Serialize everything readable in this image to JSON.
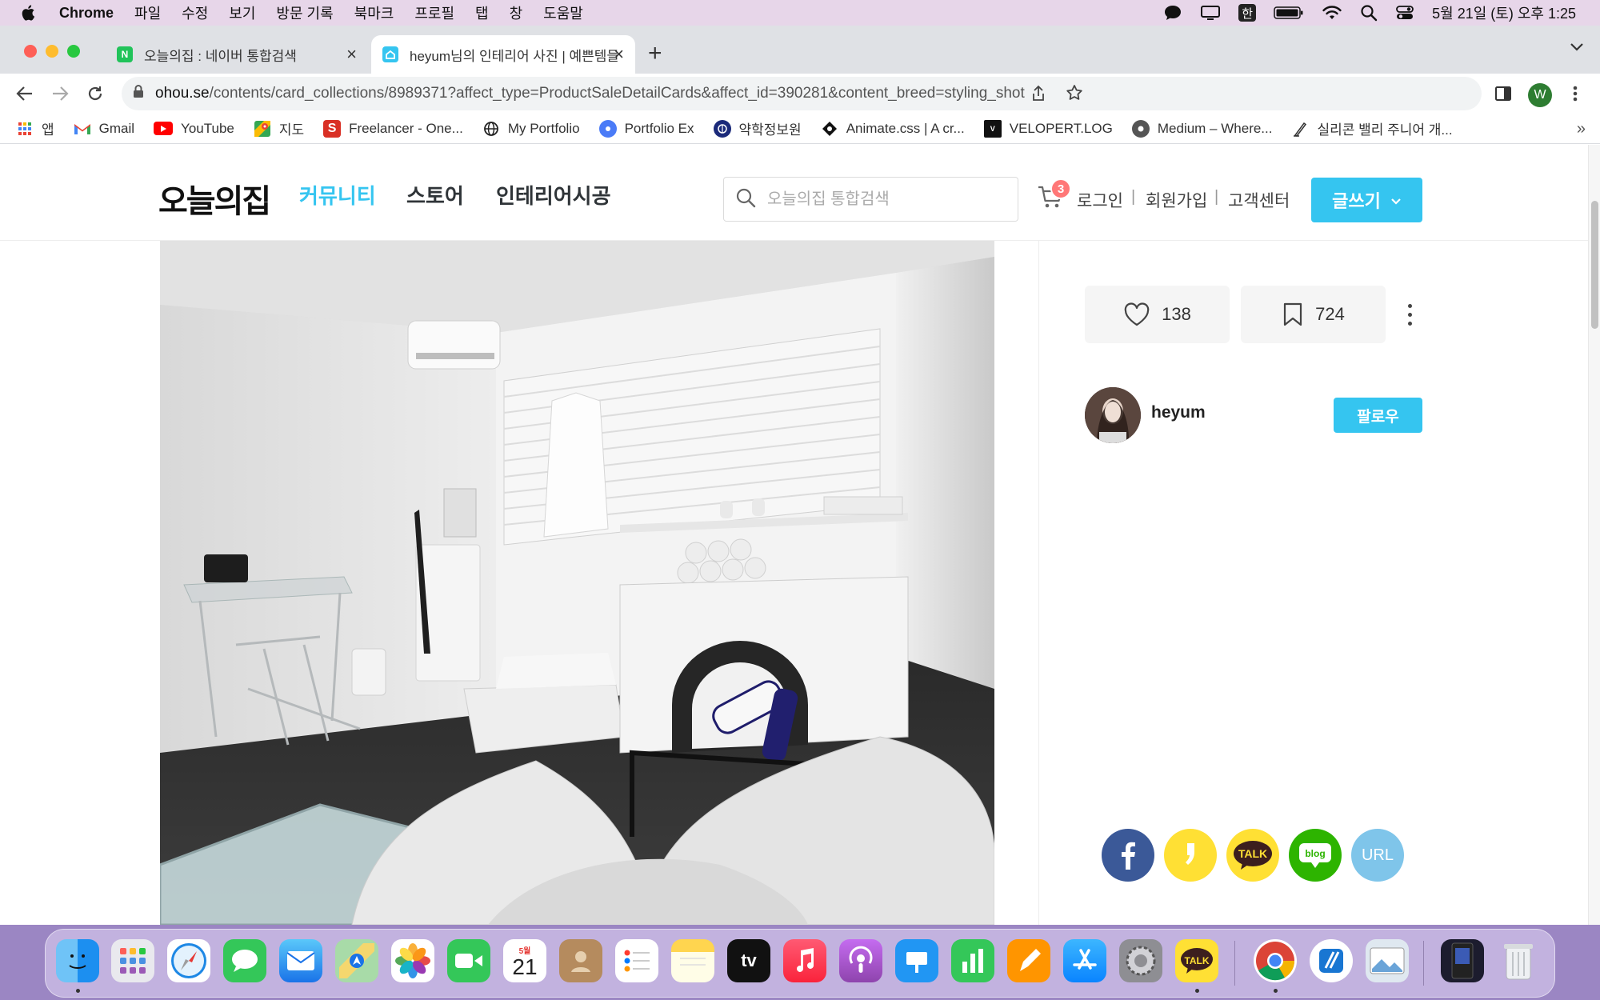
{
  "menubar": {
    "app_name": "Chrome",
    "items": [
      "파일",
      "수정",
      "보기",
      "방문 기록",
      "북마크",
      "프로필",
      "탭",
      "창",
      "도움말"
    ],
    "input_method": "한",
    "clock": "5월 21일 (토) 오후 1:25"
  },
  "tabs": [
    {
      "title": "오늘의집 : 네이버 통합검색",
      "favicon": "N",
      "active": false
    },
    {
      "title": "heyum님의 인테리어 사진 | 예쁜템들",
      "favicon": "house",
      "active": true
    }
  ],
  "toolbar": {
    "url_host": "ohou.se",
    "url_path": "/contents/card_collections/8989371?affect_type=ProductSaleDetailCards&affect_id=390281&content_breed=styling_shot",
    "profile_initial": "W"
  },
  "bookmarks": {
    "items": [
      {
        "label": "앱",
        "icon": "apps-grid-icon"
      },
      {
        "label": "Gmail",
        "icon": "gmail-icon"
      },
      {
        "label": "YouTube",
        "icon": "youtube-icon"
      },
      {
        "label": "지도",
        "icon": "maps-icon"
      },
      {
        "label": "Freelancer - One...",
        "icon": "freelancer-icon"
      },
      {
        "label": "My Portfolio",
        "icon": "globe-icon"
      },
      {
        "label": "Portfolio Ex",
        "icon": "portfolio-icon"
      },
      {
        "label": "약학정보원",
        "icon": "pharm-icon"
      },
      {
        "label": "Animate.css | A cr...",
        "icon": "animate-icon"
      },
      {
        "label": "VELOPERT.LOG",
        "icon": "velopert-icon"
      },
      {
        "label": "Medium – Where...",
        "icon": "medium-icon"
      },
      {
        "label": "실리콘 밸리 주니어 개...",
        "icon": "pen-icon"
      }
    ],
    "more": "»"
  },
  "site": {
    "logo": "오늘의집",
    "nav": [
      "커뮤니티",
      "스토어",
      "인테리어시공"
    ],
    "search_placeholder": "오늘의집 통합검색",
    "cart_count": "3",
    "links": [
      "로그인",
      "회원가입",
      "고객센터"
    ],
    "separator": "|",
    "write_button": "글쓰기",
    "accent_color": "#35c5f0"
  },
  "post": {
    "likes": "138",
    "bookmarks": "724",
    "author": "heyum",
    "follow_label": "팔로우",
    "share": [
      {
        "name": "facebook",
        "label": "f",
        "color": "#3b5998"
      },
      {
        "name": "kakaostory",
        "label": "",
        "color": "#ffe034"
      },
      {
        "name": "kakaotalk",
        "label": "TALK",
        "color": "#ffe034"
      },
      {
        "name": "naver-blog",
        "label": "blog",
        "color": "#2db400"
      },
      {
        "name": "url",
        "label": "URL",
        "color": "#7fc5ea"
      }
    ]
  },
  "dock": {
    "calendar_month": "5월",
    "calendar_day": "21",
    "tv_label": "tv",
    "talk_label": "TALK"
  }
}
